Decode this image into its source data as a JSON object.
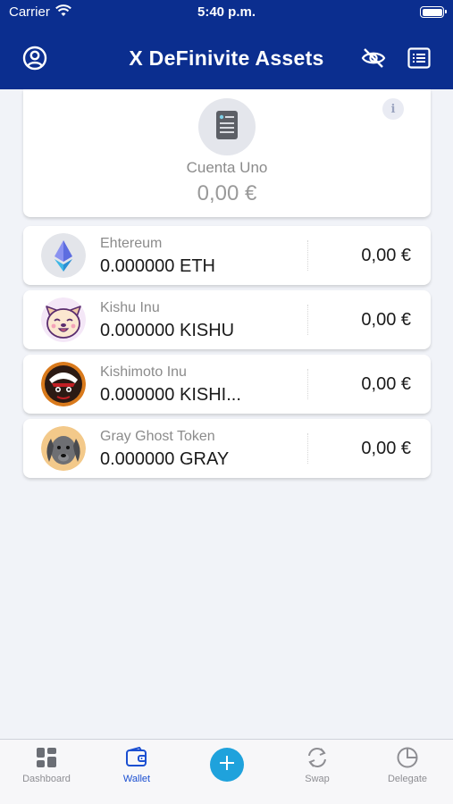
{
  "status_bar": {
    "carrier": "Carrier",
    "time": "5:40 p.m."
  },
  "header": {
    "title": "X DeFinivite Assets"
  },
  "account": {
    "name": "Cuenta Uno",
    "balance": "0,00 €",
    "info_label": "i"
  },
  "tokens": [
    {
      "name": "Ehtereum",
      "amount": "0.000000 ETH",
      "value": "0,00 €",
      "icon": "ethereum-icon"
    },
    {
      "name": "Kishu Inu",
      "amount": "0.000000 KISHU",
      "value": "0,00 €",
      "icon": "kishu-inu-icon"
    },
    {
      "name": "Kishimoto Inu",
      "amount": "0.000000 KISHI...",
      "value": "0,00 €",
      "icon": "kishimoto-inu-icon"
    },
    {
      "name": "Gray Ghost Token",
      "amount": "0.000000 GRAY",
      "value": "0,00 €",
      "icon": "gray-ghost-icon"
    }
  ],
  "tabbar": {
    "tabs": [
      {
        "label": "Dashboard",
        "active": false
      },
      {
        "label": "Wallet",
        "active": true
      },
      {
        "label": "Swap",
        "active": false
      },
      {
        "label": "Delegate",
        "active": false
      }
    ]
  },
  "colors": {
    "header_bg": "#0b2e8f",
    "accent": "#1b4fd1",
    "add_button": "#1fa2dc",
    "background": "#f1f3f8"
  }
}
